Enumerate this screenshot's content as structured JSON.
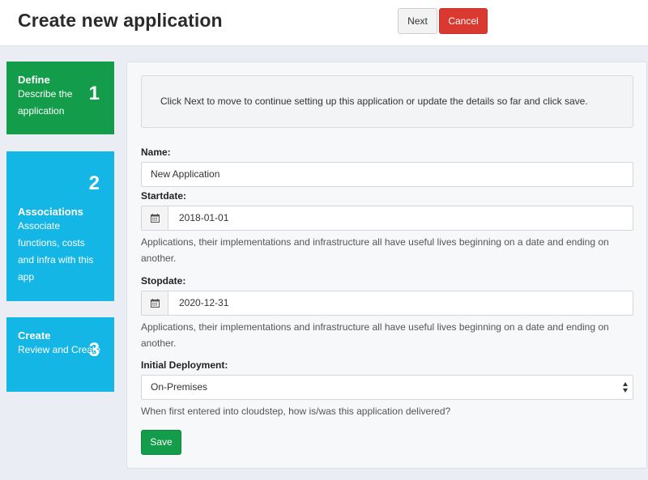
{
  "header": {
    "title": "Create new application",
    "next_label": "Next",
    "cancel_label": "Cancel"
  },
  "steps": [
    {
      "title": "Define",
      "description": "Describe the application",
      "number": "1",
      "active": true
    },
    {
      "title": "Associations",
      "description": "Associate functions, costs and infra with this app",
      "number": "2",
      "active": false
    },
    {
      "title": "Create",
      "description": "Review and Create",
      "number": "3",
      "active": false
    }
  ],
  "form": {
    "info_text": "Click Next to move to continue setting up this application or update the details so far and click save.",
    "name_label": "Name:",
    "name_value": "New Application",
    "startdate_label": "Startdate:",
    "startdate_value": "2018-01-01",
    "startdate_help": "Applications, their implementations and infrastructure all have useful lives beginning on a date and ending on another.",
    "stopdate_label": "Stopdate:",
    "stopdate_value": "2020-12-31",
    "stopdate_help": "Applications, their implementations and infrastructure all have useful lives beginning on a date and ending on another.",
    "deployment_label": "Initial Deployment:",
    "deployment_value": "On-Premises",
    "deployment_help": "When first entered into cloudstep, how is/was this application delivered?",
    "save_label": "Save"
  },
  "colors": {
    "active_step": "#139d4a",
    "inactive_step": "#14b6e6",
    "cancel": "#d9392e",
    "save": "#139d4a"
  },
  "icons": {
    "date_addon": "calendar-icon",
    "select": "select-arrows-icon"
  }
}
